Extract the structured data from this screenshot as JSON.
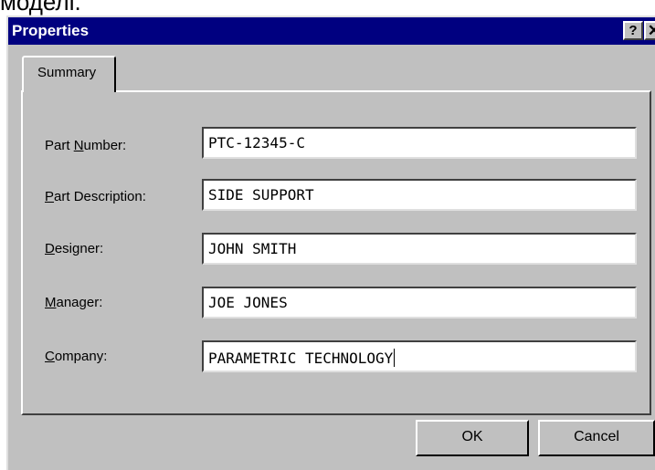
{
  "background_text": "моделі.",
  "window": {
    "title": "Properties",
    "help_label": "?",
    "close_label": "✕"
  },
  "tabs": [
    {
      "label": "Summary"
    }
  ],
  "fields": [
    {
      "label_before": "Part ",
      "label_mnemonic": "N",
      "label_after": "umber:",
      "value": "PTC-12345-C"
    },
    {
      "label_before": "",
      "label_mnemonic": "P",
      "label_after": "art Description:",
      "value": "SIDE SUPPORT"
    },
    {
      "label_before": "",
      "label_mnemonic": "D",
      "label_after": "esigner:",
      "value": "JOHN SMITH"
    },
    {
      "label_before": "",
      "label_mnemonic": "M",
      "label_after": "anager:",
      "value": "JOE JONES"
    },
    {
      "label_before": "",
      "label_mnemonic": "C",
      "label_after": "ompany:",
      "value": "PARAMETRIC TECHNOLOGY"
    }
  ],
  "buttons": {
    "ok_label": "OK",
    "cancel_label": "Cancel"
  },
  "colors": {
    "titlebar": "#000080",
    "dialog_face": "#c0c0c0"
  }
}
